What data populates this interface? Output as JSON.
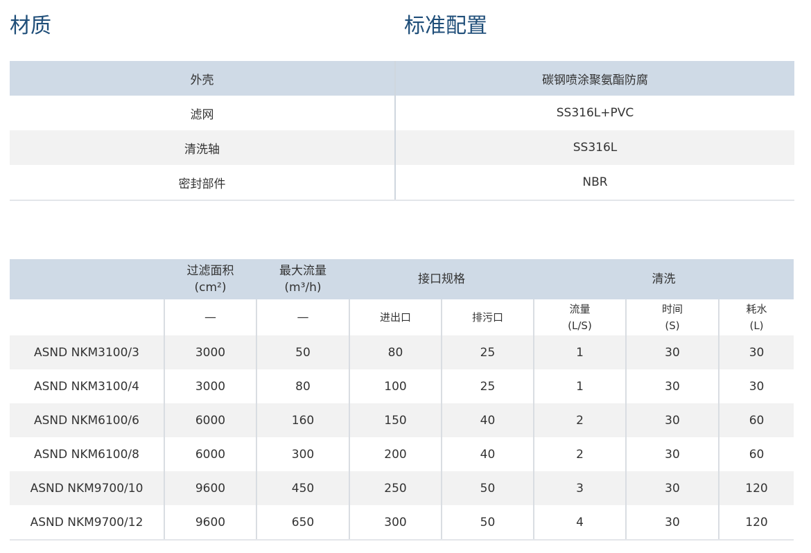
{
  "headings": {
    "materials": "材质",
    "standard_config": "标准配置"
  },
  "materials": [
    {
      "part": "外壳",
      "material": "碳钢喷涂聚氨酯防腐"
    },
    {
      "part": "滤网",
      "material": "SS316L+PVC"
    },
    {
      "part": "清洗轴",
      "material": "SS316L"
    },
    {
      "part": "密封部件",
      "material": "NBR"
    }
  ],
  "spec": {
    "header1": {
      "model": "",
      "filter_area": "过滤面积",
      "filter_area_unit": "(cm²)",
      "max_flow": "最大流量",
      "max_flow_unit": "(m³/h)",
      "ports": "接口规格",
      "cleaning": "清洗"
    },
    "header2": {
      "model": "",
      "filter_area": "—",
      "max_flow": "—",
      "inlet_outlet": "进出口",
      "drain": "排污口",
      "clean_flow": "流量",
      "clean_flow_unit": "(L/S)",
      "time": "时间",
      "time_unit": "(S)",
      "water": "耗水",
      "water_unit": "(L)"
    },
    "rows": [
      [
        "ASND NKM3100/3",
        "3000",
        "50",
        "80",
        "25",
        "1",
        "30",
        "30"
      ],
      [
        "ASND NKM3100/4",
        "3000",
        "80",
        "100",
        "25",
        "1",
        "30",
        "30"
      ],
      [
        "ASND NKM6100/6",
        "6000",
        "160",
        "150",
        "40",
        "2",
        "30",
        "60"
      ],
      [
        "ASND NKM6100/8",
        "6000",
        "300",
        "200",
        "40",
        "2",
        "30",
        "60"
      ],
      [
        "ASND NKM9700/10",
        "9600",
        "450",
        "250",
        "50",
        "3",
        "30",
        "120"
      ],
      [
        "ASND NKM9700/12",
        "9600",
        "650",
        "300",
        "50",
        "4",
        "30",
        "120"
      ]
    ]
  }
}
